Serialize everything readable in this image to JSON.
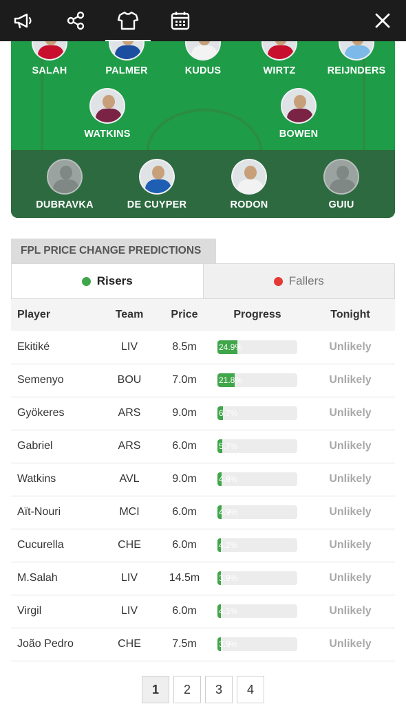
{
  "toolbar": {
    "icons": [
      "megaphone-icon",
      "share-icon",
      "shirt-icon",
      "calendar-icon",
      "close-icon"
    ],
    "active": "shirt-icon"
  },
  "pitch": {
    "midfield": [
      {
        "name": "SALAH",
        "shirt": "#c8102e"
      },
      {
        "name": "PALMER",
        "shirt": "#1d4fa0"
      },
      {
        "name": "KUDUS",
        "shirt": "#f3f3f3"
      },
      {
        "name": "WIRTZ",
        "shirt": "#c8102e"
      },
      {
        "name": "REIJNDERS",
        "shirt": "#7cb9e8"
      }
    ],
    "forwards": [
      {
        "name": "WATKINS",
        "shirt": "#7a2345"
      },
      {
        "name": "BOWEN",
        "shirt": "#7a2345"
      }
    ],
    "bench": [
      {
        "name": "DUBRAVKA",
        "ghost": true
      },
      {
        "name": "DE CUYPER",
        "shirt": "#1e5fb3"
      },
      {
        "name": "RODON",
        "shirt": "#f2f2f2"
      },
      {
        "name": "GUIU",
        "ghost": true
      }
    ]
  },
  "predictions": {
    "title": "FPL PRICE CHANGE PREDICTIONS",
    "tabs": [
      {
        "label": "Risers",
        "color": "#3fa64a",
        "active": true
      },
      {
        "label": "Fallers",
        "color": "#e53935",
        "active": false
      }
    ],
    "columns": [
      "Player",
      "Team",
      "Price",
      "Progress",
      "Tonight"
    ],
    "rows": [
      {
        "player": "Ekitiké",
        "team": "LIV",
        "price": "8.5m",
        "progress_label": "24.9%",
        "progress": 24.9,
        "tonight": "Unlikely"
      },
      {
        "player": "Semenyo",
        "team": "BOU",
        "price": "7.0m",
        "progress_label": "21.8%",
        "progress": 21.8,
        "tonight": "Unlikely"
      },
      {
        "player": "Gyökeres",
        "team": "ARS",
        "price": "9.0m",
        "progress_label": "6.7%",
        "progress": 6.7,
        "tonight": "Unlikely"
      },
      {
        "player": "Gabriel",
        "team": "ARS",
        "price": "6.0m",
        "progress_label": "5.7%",
        "progress": 5.7,
        "tonight": "Unlikely"
      },
      {
        "player": "Watkins",
        "team": "AVL",
        "price": "9.0m",
        "progress_label": "4.9%",
        "progress": 4.9,
        "tonight": "Unlikely"
      },
      {
        "player": "Aït-Nouri",
        "team": "MCI",
        "price": "6.0m",
        "progress_label": "4.9%",
        "progress": 4.9,
        "tonight": "Unlikely"
      },
      {
        "player": "Cucurella",
        "team": "CHE",
        "price": "6.0m",
        "progress_label": "4.2%",
        "progress": 4.2,
        "tonight": "Unlikely"
      },
      {
        "player": "M.Salah",
        "team": "LIV",
        "price": "14.5m",
        "progress_label": "3.9%",
        "progress": 3.9,
        "tonight": "Unlikely"
      },
      {
        "player": "Virgil",
        "team": "LIV",
        "price": "6.0m",
        "progress_label": "4.1%",
        "progress": 4.1,
        "tonight": "Unlikely"
      },
      {
        "player": "João Pedro",
        "team": "CHE",
        "price": "7.5m",
        "progress_label": "3.9%",
        "progress": 3.9,
        "tonight": "Unlikely"
      }
    ]
  },
  "pagination": {
    "pages": [
      "1",
      "2",
      "3",
      "4"
    ],
    "current": "1"
  }
}
